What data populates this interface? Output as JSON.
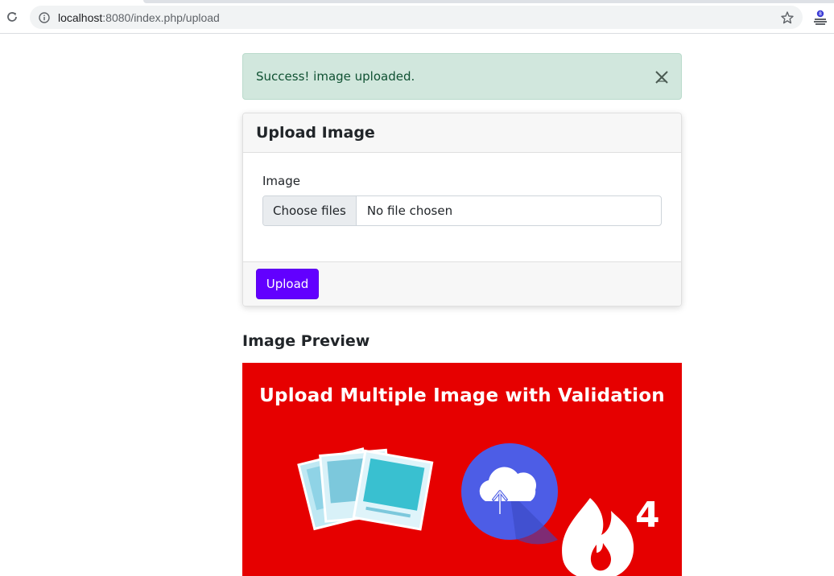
{
  "browser": {
    "url_host": "localhost",
    "url_rest": ":8080/index.php/upload"
  },
  "alert": {
    "message": "Success! image uploaded."
  },
  "upload_card": {
    "title": "Upload Image",
    "field_label": "Image",
    "file_button_label": "Choose files",
    "file_status": "No file chosen",
    "submit_label": "Upload"
  },
  "preview": {
    "title": "Image Preview",
    "banner_text": "Upload Multiple Image with Validation",
    "banner_badge": "4"
  },
  "colors": {
    "banner_background": "#e60000",
    "upload_button": "#6200ff",
    "alert_background": "#d1e7dd",
    "alert_text": "#0f5132"
  }
}
